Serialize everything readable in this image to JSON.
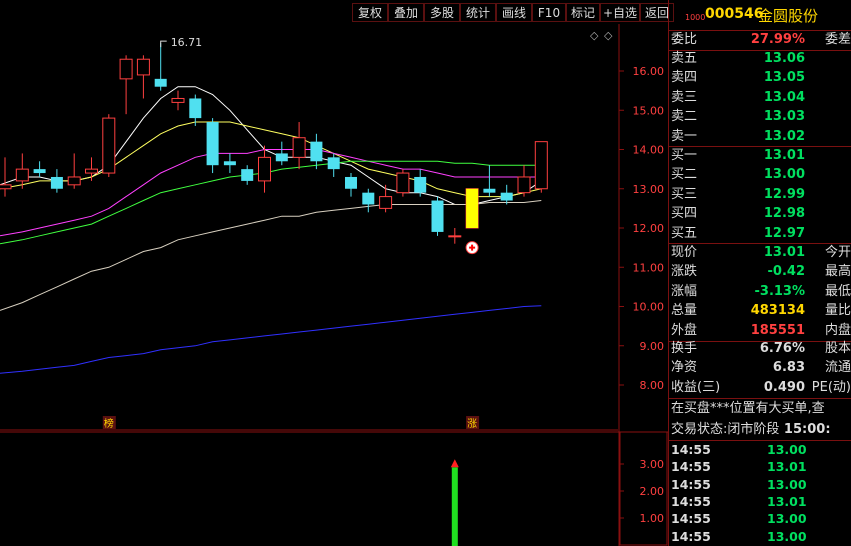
{
  "toolbar": {
    "buttons": [
      "复权",
      "叠加",
      "多股",
      "统计",
      "画线",
      "F10",
      "标记",
      "+自选",
      "返回"
    ]
  },
  "header": {
    "code_prefix": "1000",
    "code": "000546",
    "name": "金圆股份"
  },
  "quote": {
    "weibi": {
      "label": "委比",
      "value": "27.99%",
      "label2": "委差",
      "color": "#ff4040"
    },
    "asks": [
      {
        "label": "卖五",
        "price": "13.06"
      },
      {
        "label": "卖四",
        "price": "13.05"
      },
      {
        "label": "卖三",
        "price": "13.04"
      },
      {
        "label": "卖二",
        "price": "13.03"
      },
      {
        "label": "卖一",
        "price": "13.02"
      }
    ],
    "bids": [
      {
        "label": "买一",
        "price": "13.01"
      },
      {
        "label": "买二",
        "price": "13.00"
      },
      {
        "label": "买三",
        "price": "12.99"
      },
      {
        "label": "买四",
        "price": "12.98"
      },
      {
        "label": "买五",
        "price": "12.97"
      }
    ],
    "stats": [
      {
        "label": "现价",
        "value": "13.01",
        "label2": "今开",
        "color": "#00e060"
      },
      {
        "label": "涨跌",
        "value": "-0.42",
        "label2": "最高",
        "color": "#00e060"
      },
      {
        "label": "涨幅",
        "value": "-3.13%",
        "label2": "最低",
        "color": "#00e060"
      },
      {
        "label": "总量",
        "value": "483134",
        "label2": "量比",
        "color": "#ffd700"
      },
      {
        "label": "外盘",
        "value": "185551",
        "label2": "内盘",
        "color": "#ff4040"
      }
    ],
    "stats2": [
      {
        "label": "换手",
        "value": "6.76%",
        "label2": "股本",
        "color": "#dddddd"
      },
      {
        "label": "净资",
        "value": "6.83",
        "label2": "流通",
        "color": "#dddddd"
      },
      {
        "label": "收益(三)",
        "value": "0.490",
        "label2": "PE(动)",
        "color": "#dddddd"
      }
    ],
    "message": "在买盘***位置有大买单,查",
    "status_label": "交易状态:",
    "status_value": "闭市阶段",
    "status_time": "15:00:",
    "ticks": [
      {
        "time": "14:55",
        "price": "13.00"
      },
      {
        "time": "14:55",
        "price": "13.01"
      },
      {
        "time": "14:55",
        "price": "13.00"
      },
      {
        "time": "14:55",
        "price": "13.01"
      },
      {
        "time": "14:55",
        "price": "13.00"
      },
      {
        "time": "14:55",
        "price": "13.00"
      }
    ]
  },
  "chart_data": {
    "type": "candlestick",
    "price_axis": [
      "16.00",
      "15.00",
      "14.00",
      "13.00",
      "12.00",
      "11.00",
      "10.00",
      "9.00",
      "8.00"
    ],
    "volume_axis": [
      "3.00",
      "2.00",
      "1.00"
    ],
    "high_label": "16.71",
    "markers": [
      {
        "text": "榜"
      },
      {
        "text": "涨"
      }
    ],
    "candles": [
      {
        "o": 13.0,
        "c": 13.1,
        "h": 13.8,
        "l": 12.8
      },
      {
        "o": 13.2,
        "c": 13.5,
        "h": 13.9,
        "l": 13.0
      },
      {
        "o": 13.5,
        "c": 13.4,
        "h": 13.7,
        "l": 13.3
      },
      {
        "o": 13.3,
        "c": 13.0,
        "h": 13.5,
        "l": 12.9
      },
      {
        "o": 13.1,
        "c": 13.3,
        "h": 13.9,
        "l": 13.0
      },
      {
        "o": 13.4,
        "c": 13.5,
        "h": 13.8,
        "l": 13.2
      },
      {
        "o": 13.4,
        "c": 14.8,
        "h": 14.9,
        "l": 13.3
      },
      {
        "o": 15.8,
        "c": 16.3,
        "h": 16.4,
        "l": 14.9
      },
      {
        "o": 15.9,
        "c": 16.3,
        "h": 16.4,
        "l": 15.3
      },
      {
        "o": 15.8,
        "c": 15.6,
        "h": 16.71,
        "l": 15.5
      },
      {
        "o": 15.2,
        "c": 15.3,
        "h": 15.5,
        "l": 15.0
      },
      {
        "o": 15.3,
        "c": 14.8,
        "h": 15.4,
        "l": 14.6
      },
      {
        "o": 14.7,
        "c": 13.6,
        "h": 14.8,
        "l": 13.4
      },
      {
        "o": 13.7,
        "c": 13.6,
        "h": 13.9,
        "l": 13.4
      },
      {
        "o": 13.5,
        "c": 13.2,
        "h": 13.6,
        "l": 13.1
      },
      {
        "o": 13.2,
        "c": 13.8,
        "h": 14.1,
        "l": 12.9
      },
      {
        "o": 13.9,
        "c": 13.7,
        "h": 14.2,
        "l": 13.6
      },
      {
        "o": 13.8,
        "c": 14.3,
        "h": 14.7,
        "l": 13.5
      },
      {
        "o": 14.2,
        "c": 13.7,
        "h": 14.4,
        "l": 13.5
      },
      {
        "o": 13.8,
        "c": 13.5,
        "h": 13.9,
        "l": 13.3
      },
      {
        "o": 13.3,
        "c": 13.0,
        "h": 13.4,
        "l": 12.8
      },
      {
        "o": 12.9,
        "c": 12.6,
        "h": 13.0,
        "l": 12.4
      },
      {
        "o": 12.5,
        "c": 12.8,
        "h": 13.1,
        "l": 12.4
      },
      {
        "o": 12.9,
        "c": 13.4,
        "h": 13.5,
        "l": 12.8
      },
      {
        "o": 13.3,
        "c": 12.9,
        "h": 13.5,
        "l": 12.8
      },
      {
        "o": 12.7,
        "c": 11.9,
        "h": 12.8,
        "l": 11.8
      },
      {
        "o": 11.8,
        "c": 11.8,
        "h": 12.0,
        "l": 11.6
      },
      {
        "o": 12.0,
        "c": 13.0,
        "h": 13.0,
        "l": 12.0
      },
      {
        "o": 13.0,
        "c": 12.9,
        "h": 13.6,
        "l": 12.8
      },
      {
        "o": 12.9,
        "c": 12.7,
        "h": 13.1,
        "l": 12.6
      },
      {
        "o": 12.9,
        "c": 13.3,
        "h": 13.6,
        "l": 12.8
      },
      {
        "o": 13.0,
        "c": 14.2,
        "h": 14.2,
        "l": 12.9
      }
    ],
    "ma_lines": [
      {
        "color": "#ffffff",
        "values": [
          13.1,
          13.3,
          13.3,
          13.2,
          13.2,
          13.3,
          13.6,
          14.2,
          14.8,
          15.3,
          15.6,
          15.6,
          15.4,
          15.0,
          14.5,
          14.0,
          13.8,
          13.8,
          13.8,
          13.7,
          13.6,
          13.3,
          13.0,
          12.9,
          12.9,
          12.8,
          12.6,
          12.6,
          12.7,
          12.8,
          12.9,
          13.2
        ]
      },
      {
        "color": "#ffff60",
        "values": [
          13.0,
          13.1,
          13.2,
          13.2,
          13.2,
          13.3,
          13.5,
          13.8,
          14.1,
          14.4,
          14.6,
          14.7,
          14.7,
          14.7,
          14.6,
          14.5,
          14.4,
          14.3,
          14.1,
          13.9,
          13.7,
          13.5,
          13.4,
          13.3,
          13.2,
          13.0,
          12.9,
          12.8,
          12.8,
          12.8,
          12.9,
          13.0
        ]
      },
      {
        "color": "#ff40ff",
        "values": [
          11.8,
          11.9,
          12.0,
          12.1,
          12.2,
          12.3,
          12.5,
          12.8,
          13.1,
          13.4,
          13.6,
          13.8,
          13.9,
          13.9,
          13.9,
          14.0,
          14.0,
          14.0,
          14.0,
          13.9,
          13.8,
          13.7,
          13.6,
          13.5,
          13.5,
          13.4,
          13.3,
          13.3,
          13.3,
          13.3,
          13.3,
          13.3
        ]
      },
      {
        "color": "#40ff40",
        "values": [
          11.6,
          11.7,
          11.8,
          11.9,
          12.0,
          12.1,
          12.3,
          12.5,
          12.7,
          12.9,
          13.0,
          13.1,
          13.2,
          13.3,
          13.35,
          13.4,
          13.5,
          13.55,
          13.6,
          13.65,
          13.7,
          13.7,
          13.7,
          13.7,
          13.7,
          13.7,
          13.65,
          13.65,
          13.6,
          13.6,
          13.6,
          13.6
        ]
      },
      {
        "color": "#d8d0c0",
        "values": [
          9.9,
          10.1,
          10.3,
          10.5,
          10.7,
          10.9,
          11.0,
          11.2,
          11.4,
          11.5,
          11.7,
          11.8,
          11.9,
          12.0,
          12.1,
          12.2,
          12.3,
          12.3,
          12.4,
          12.45,
          12.5,
          12.55,
          12.6,
          12.6,
          12.6,
          12.6,
          12.6,
          12.6,
          12.65,
          12.65,
          12.65,
          12.7
        ]
      },
      {
        "color": "#3030ff",
        "values": [
          8.3,
          8.35,
          8.4,
          8.45,
          8.5,
          8.6,
          8.7,
          8.75,
          8.8,
          8.9,
          8.95,
          9.0,
          9.1,
          9.15,
          9.2,
          9.25,
          9.3,
          9.35,
          9.4,
          9.45,
          9.5,
          9.55,
          9.6,
          9.65,
          9.7,
          9.75,
          9.8,
          9.85,
          9.9,
          9.95,
          10.0,
          10.02
        ]
      }
    ],
    "volume_bar": {
      "index": 26,
      "value": 3.1
    }
  }
}
